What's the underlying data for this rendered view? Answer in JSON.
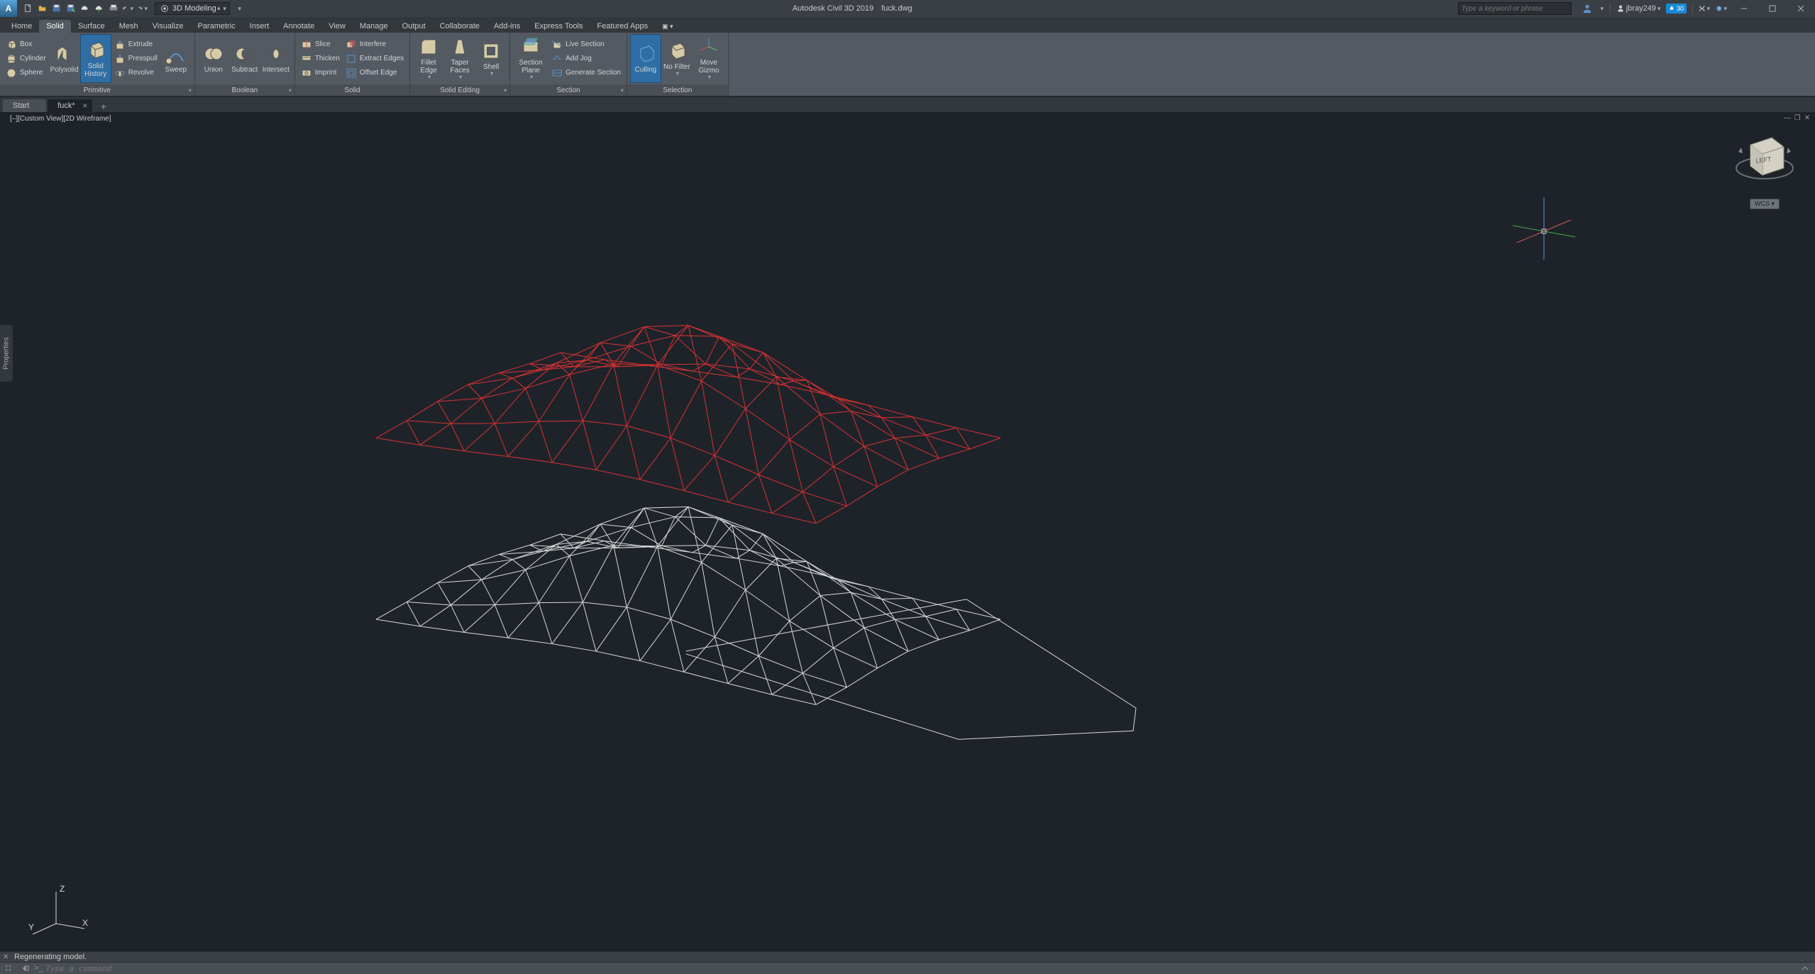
{
  "app": {
    "logo_letter": "A",
    "workspace_label": "3D Modeling",
    "title_app": "Autodesk Civil 3D 2019",
    "title_file": "fuck.dwg",
    "search_placeholder": "Type a keyword or phrase",
    "user_name": "jbray249",
    "badge_text": "30",
    "properties_tab": "Properties",
    "wcs_label": "WCS",
    "ucs": {
      "x": "X",
      "y": "Y",
      "z": "Z"
    },
    "viewcube_face": "LEFT"
  },
  "ribbon_tabs": {
    "items": [
      "Home",
      "Solid",
      "Surface",
      "Mesh",
      "Visualize",
      "Parametric",
      "Insert",
      "Annotate",
      "View",
      "Manage",
      "Output",
      "Collaborate",
      "Add-ins",
      "Express Tools",
      "Featured Apps"
    ],
    "active_index": 1
  },
  "ribbon": {
    "primitive": {
      "title": "Primitive",
      "box": "Box",
      "cylinder": "Cylinder",
      "sphere": "Sphere",
      "polysolid": "Polysolid",
      "solid_history": "Solid History",
      "extrude": "Extrude",
      "presspull": "Presspull",
      "revolve": "Revolve",
      "sweep": "Sweep"
    },
    "boolean": {
      "title": "Boolean",
      "union": "Union",
      "subtract": "Subtract",
      "intersect": "Intersect"
    },
    "solid": {
      "title": "Solid",
      "slice": "Slice",
      "thicken": "Thicken",
      "imprint": "Imprint",
      "interfere": "Interfere",
      "extract_edges": "Extract Edges",
      "offset_edge": "Offset Edge"
    },
    "solid_editing": {
      "title": "Solid Editing",
      "fillet_edge": "Fillet Edge",
      "taper_faces": "Taper Faces",
      "shell": "Shell"
    },
    "section": {
      "title": "Section",
      "section_plane": "Section\nPlane",
      "live_section": "Live Section",
      "add_jog": "Add Jog",
      "generate_section": "Generate Section"
    },
    "selection": {
      "title": "Selection",
      "culling": "Culling",
      "no_filter": "No Filter",
      "move_gizmo": "Move\nGizmo"
    }
  },
  "file_tabs": {
    "start": "Start",
    "doc": "fuck*"
  },
  "viewport": {
    "control": "[–][Custom View][2D Wireframe]"
  },
  "cmd": {
    "history": "Regenerating model.",
    "placeholder": "Type a command",
    "prompt": ">_"
  }
}
